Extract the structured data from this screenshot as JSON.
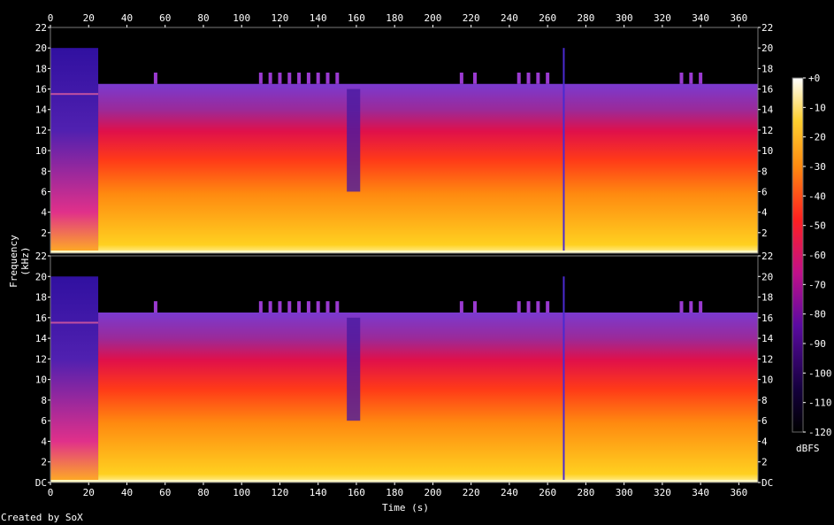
{
  "credit": "Created by SoX",
  "chart_data": {
    "type": "heatmap",
    "title": "",
    "xlabel": "Time (s)",
    "ylabel": "Frequency (kHz)",
    "xlim": [
      0,
      370
    ],
    "ylim": [
      0,
      22
    ],
    "x_ticks": [
      "0",
      "20",
      "40",
      "60",
      "80",
      "100",
      "120",
      "140",
      "160",
      "180",
      "200",
      "220",
      "240",
      "260",
      "280",
      "300",
      "320",
      "340",
      "360"
    ],
    "y_ticks": [
      "DC",
      "2",
      "4",
      "6",
      "8",
      "10",
      "12",
      "14",
      "16",
      "18",
      "20",
      "22"
    ],
    "channels": [
      "top",
      "bottom"
    ],
    "colorbar": {
      "unit": "dBFS",
      "ticks": [
        "+0",
        "-10",
        "-20",
        "-30",
        "-40",
        "-50",
        "-60",
        "-70",
        "-80",
        "-90",
        "-100",
        "-110",
        "-120"
      ],
      "range": [
        -120,
        0
      ]
    },
    "colors": {
      "background": "#000000",
      "low": "#14003c",
      "mid": "#ff1a1a",
      "high": "#ffffff"
    }
  }
}
